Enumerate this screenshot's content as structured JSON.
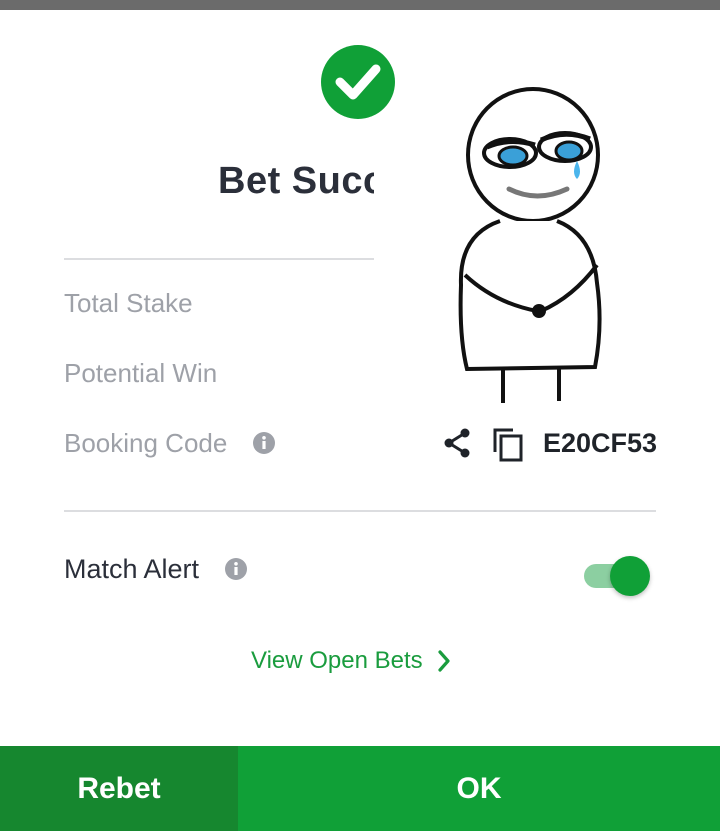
{
  "dialog": {
    "title": "Bet Succ",
    "rows": {
      "total_stake_label": "Total Stake",
      "potential_win_label": "Potential Win",
      "booking_code_label": "Booking Code",
      "booking_code_value": "E20CF53"
    },
    "match_alert": {
      "label": "Match Alert",
      "enabled": true
    },
    "view_open_bets": "View Open Bets"
  },
  "buttons": {
    "rebet": "Rebet",
    "ok": "OK"
  },
  "colors": {
    "accent_green": "#10a037",
    "dark_green": "#16872f",
    "label_gray": "#9ea1a8",
    "text_dark": "#2b2f3a"
  },
  "icons": {
    "success": "check-circle-icon",
    "info": "info-icon",
    "share": "share-icon",
    "copy": "copy-icon",
    "chevron": "chevron-right-icon"
  }
}
